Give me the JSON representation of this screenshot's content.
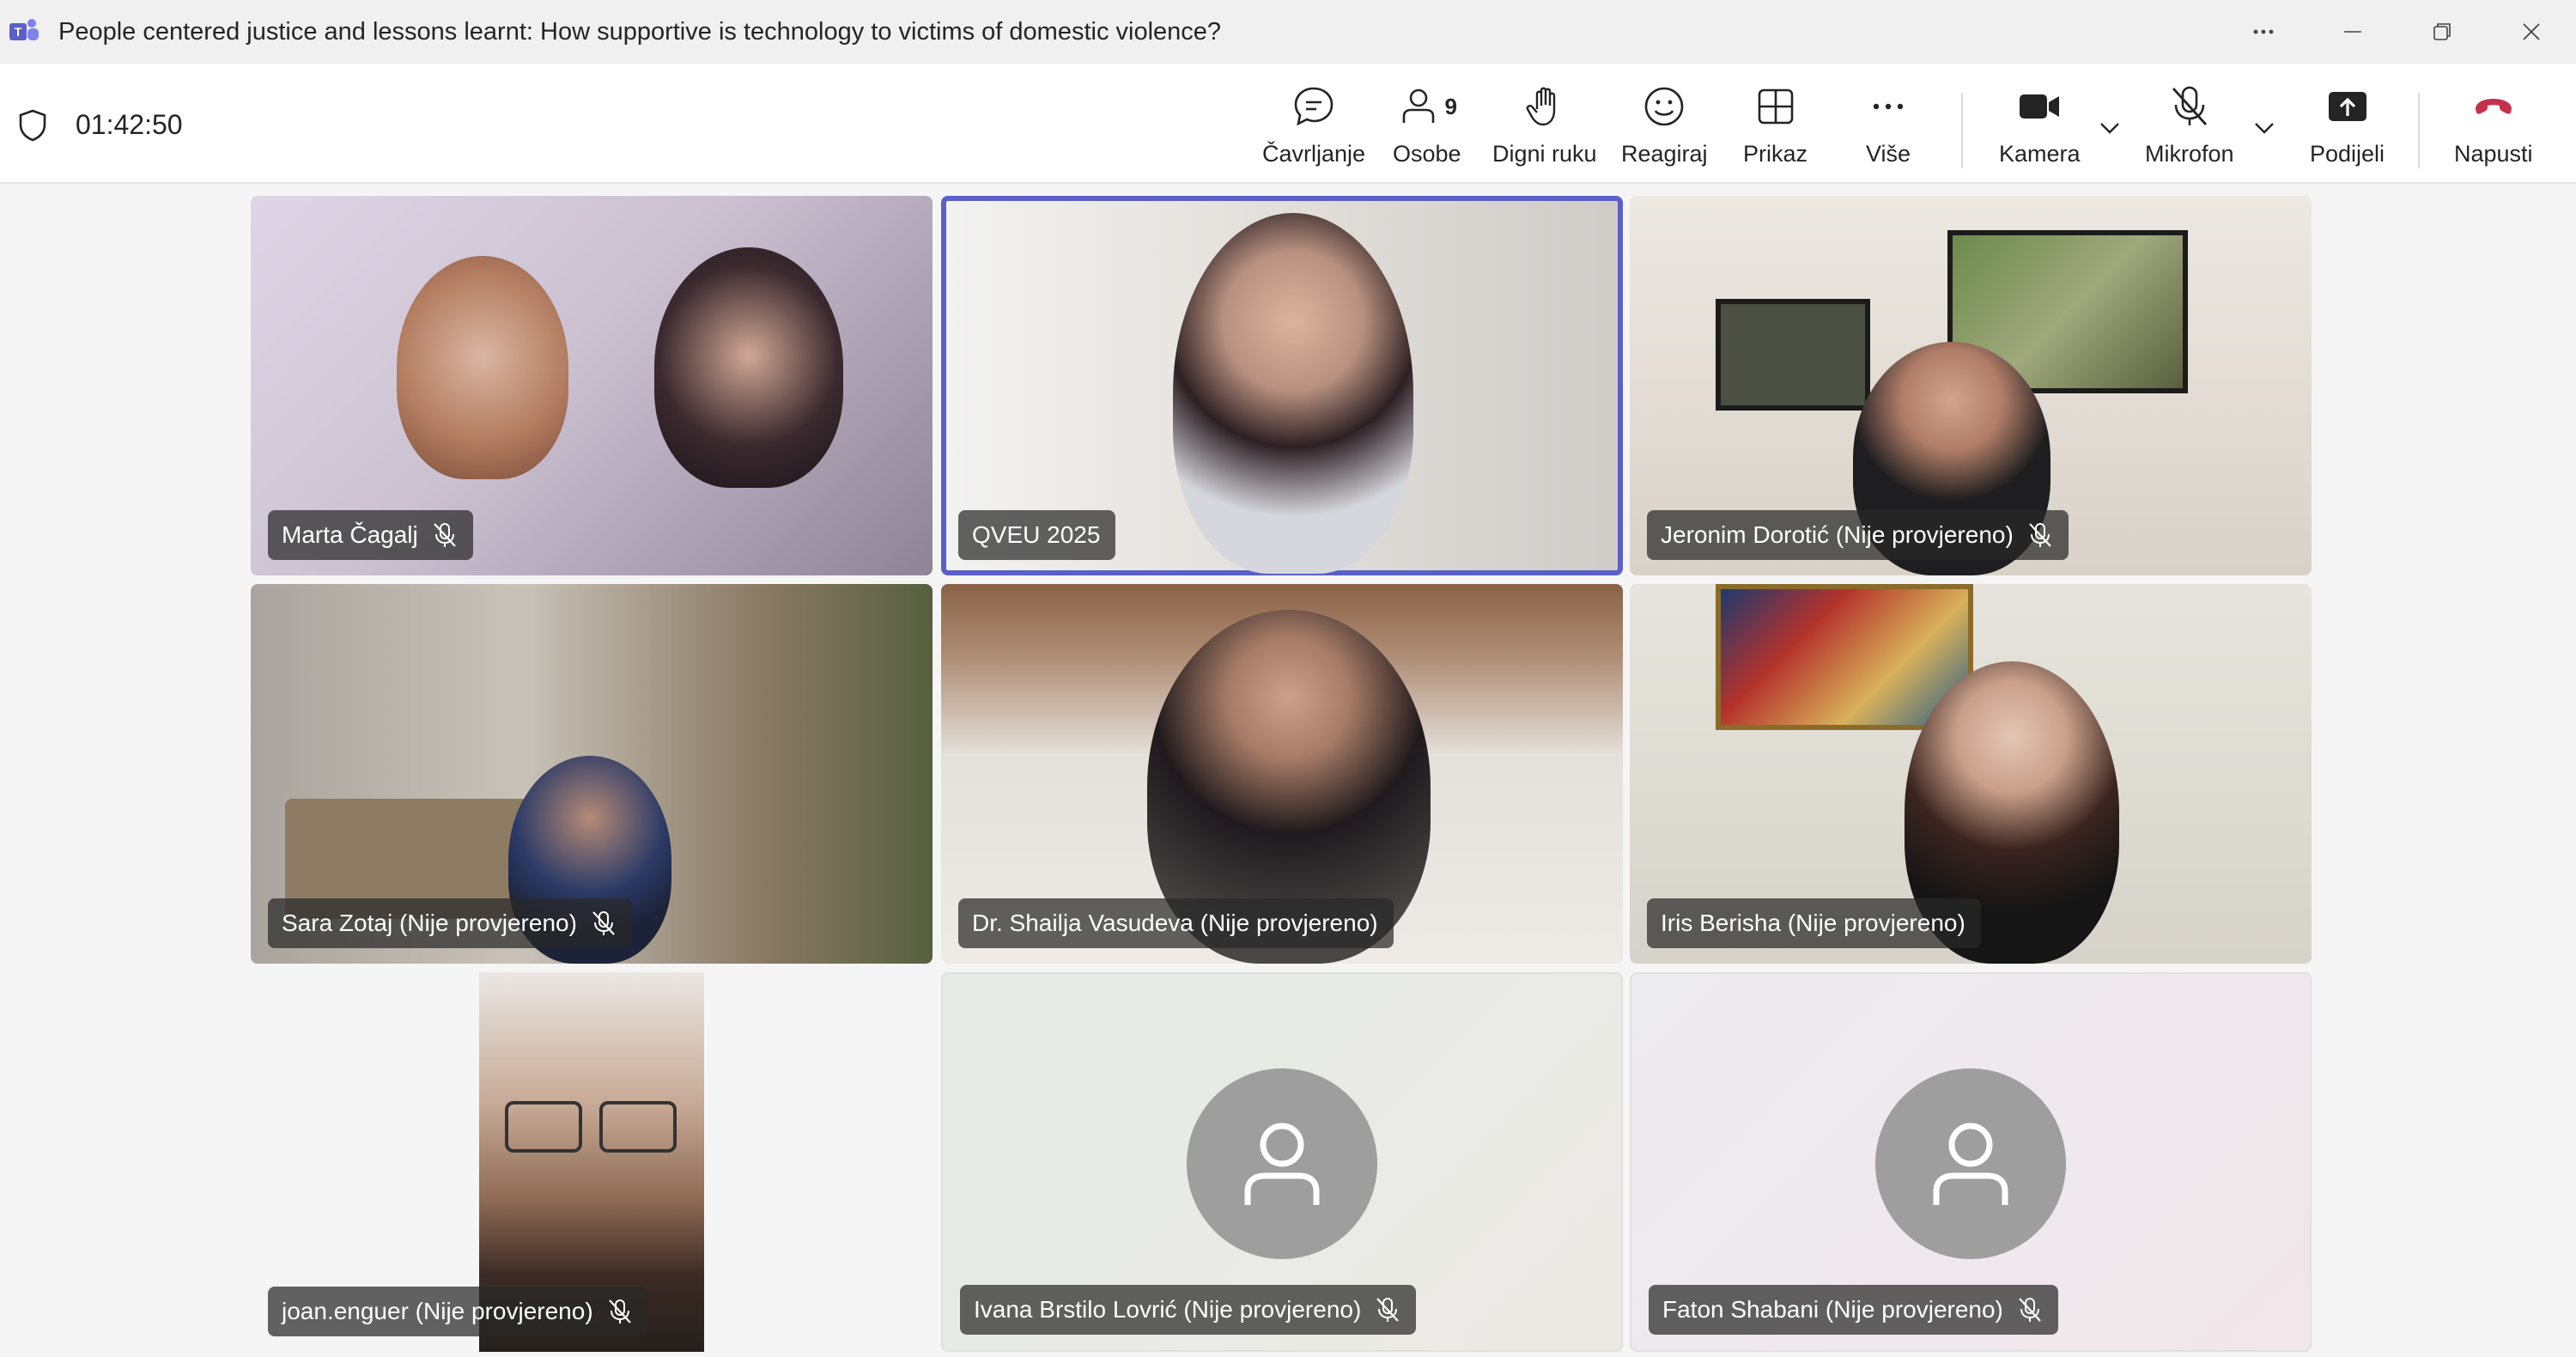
{
  "window": {
    "title": "People centered justice and lessons learnt: How supportive is technology to victims of domestic violence?"
  },
  "meeting": {
    "timer": "01:42:50",
    "participant_count": "9"
  },
  "toolbar": {
    "chat": "Čavrljanje",
    "people": "Osobe",
    "raise_hand": "Digni ruku",
    "react": "Reagiraj",
    "view": "Prikaz",
    "more": "Više",
    "camera": "Kamera",
    "mic": "Mikrofon",
    "share": "Podijeli",
    "leave": "Napusti"
  },
  "colors": {
    "accent": "#5b5fc7",
    "leave": "#c4314b"
  },
  "participants": [
    {
      "name": "Marta Čagalj",
      "muted": true
    },
    {
      "name": "QVEU 2025",
      "muted": false,
      "active": true
    },
    {
      "name": "Jeronim Dorotić (Nije provjereno)",
      "muted": true
    },
    {
      "name": "Sara Zotaj (Nije provjereno)",
      "muted": true
    },
    {
      "name": "Dr. Shailja Vasudeva (Nije provjereno)",
      "muted": false
    },
    {
      "name": "Iris Berisha (Nije provjereno)",
      "muted": false
    },
    {
      "name": "joan.enguer (Nije provjereno)",
      "muted": true
    },
    {
      "name": "Ivana Brstilo Lovrić (Nije provjereno)",
      "muted": true
    },
    {
      "name": "Faton Shabani (Nije provjereno)",
      "muted": true
    }
  ]
}
